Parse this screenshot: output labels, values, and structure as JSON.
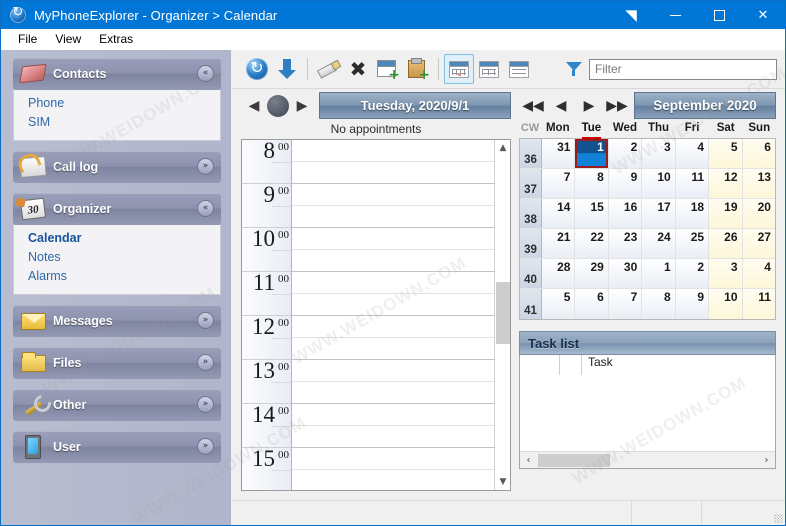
{
  "window": {
    "title": "MyPhoneExplorer -  Organizer > Calendar",
    "icon": "sync-circle-icon",
    "buttons": {
      "restore_small": "restore-triangle-icon",
      "minimize": "minimize-icon",
      "maximize": "maximize-icon",
      "close": "✕"
    }
  },
  "menu": {
    "items": [
      "File",
      "View",
      "Extras"
    ]
  },
  "sidebar": {
    "groups": [
      {
        "label": "Contacts",
        "icon": "book-icon",
        "expanded": true,
        "chevron": "«",
        "items": [
          {
            "label": "Phone",
            "selected": false
          },
          {
            "label": "SIM",
            "selected": false
          }
        ]
      },
      {
        "label": "Call log",
        "icon": "phone-log-icon",
        "expanded": false,
        "chevron": "»",
        "items": []
      },
      {
        "label": "Organizer",
        "icon": "calendar-30-icon",
        "expanded": true,
        "chevron": "«",
        "items": [
          {
            "label": "Calendar",
            "selected": true
          },
          {
            "label": "Notes",
            "selected": false
          },
          {
            "label": "Alarms",
            "selected": false
          }
        ]
      },
      {
        "label": "Messages",
        "icon": "envelope-icon",
        "expanded": false,
        "chevron": "»",
        "items": []
      },
      {
        "label": "Files",
        "icon": "folder-icon",
        "expanded": false,
        "chevron": "»",
        "items": []
      },
      {
        "label": "Other",
        "icon": "wrench-icon",
        "expanded": false,
        "chevron": "»",
        "items": []
      },
      {
        "label": "User",
        "icon": "device-icon",
        "expanded": false,
        "chevron": "»",
        "items": []
      }
    ]
  },
  "toolbar": {
    "buttons": [
      {
        "name": "sync-button",
        "icon": "sync-icon"
      },
      {
        "name": "download-button",
        "icon": "download-arrow-icon"
      },
      {
        "name": "edit-button",
        "icon": "pencil-icon"
      },
      {
        "name": "delete-button",
        "icon": "x-delete-icon"
      },
      {
        "name": "new-appointment-button",
        "icon": "calendar-plus-icon"
      },
      {
        "name": "new-task-button",
        "icon": "clipboard-plus-icon"
      },
      {
        "name": "calendar-view-button",
        "icon": "calendar-view-icon",
        "active": true
      },
      {
        "name": "table-view-button",
        "icon": "table-view-icon",
        "active": false
      },
      {
        "name": "list-view-button",
        "icon": "list-view-icon",
        "active": false
      }
    ],
    "filter": {
      "icon": "funnel-icon",
      "placeholder": "Filter",
      "value": ""
    }
  },
  "day_view": {
    "nav": {
      "prev": "◀",
      "today": "today-dot",
      "next": "▶",
      "date_label": "Tuesday, 2020/9/1"
    },
    "appointments_status": "No appointments",
    "hours": [
      {
        "hour": "8",
        "minutes": "00"
      },
      {
        "hour": "9",
        "minutes": "00"
      },
      {
        "hour": "10",
        "minutes": "00"
      },
      {
        "hour": "11",
        "minutes": "00"
      },
      {
        "hour": "12",
        "minutes": "00"
      },
      {
        "hour": "13",
        "minutes": "00"
      },
      {
        "hour": "14",
        "minutes": "00"
      },
      {
        "hour": "15",
        "minutes": "00"
      }
    ]
  },
  "month_view": {
    "nav": {
      "prev_year": "◀◀",
      "prev_month": "◀",
      "next_month": "▶",
      "next_year": "▶▶",
      "month_label": "September 2020"
    },
    "headers": {
      "cw": "CW",
      "days": [
        "Mon",
        "Tue",
        "Wed",
        "Thu",
        "Fri",
        "Sat",
        "Sun"
      ],
      "today_column": "Tue"
    },
    "weeks": [
      {
        "cw": "36",
        "days": [
          {
            "n": "31",
            "weekend": false,
            "selected": false
          },
          {
            "n": "1",
            "weekend": false,
            "selected": true
          },
          {
            "n": "2",
            "weekend": false,
            "selected": false
          },
          {
            "n": "3",
            "weekend": false,
            "selected": false
          },
          {
            "n": "4",
            "weekend": false,
            "selected": false
          },
          {
            "n": "5",
            "weekend": true,
            "selected": false
          },
          {
            "n": "6",
            "weekend": true,
            "selected": false
          }
        ]
      },
      {
        "cw": "37",
        "days": [
          {
            "n": "7",
            "weekend": false,
            "selected": false
          },
          {
            "n": "8",
            "weekend": false,
            "selected": false
          },
          {
            "n": "9",
            "weekend": false,
            "selected": false
          },
          {
            "n": "10",
            "weekend": false,
            "selected": false
          },
          {
            "n": "11",
            "weekend": false,
            "selected": false
          },
          {
            "n": "12",
            "weekend": true,
            "selected": false
          },
          {
            "n": "13",
            "weekend": true,
            "selected": false
          }
        ]
      },
      {
        "cw": "38",
        "days": [
          {
            "n": "14",
            "weekend": false,
            "selected": false
          },
          {
            "n": "15",
            "weekend": false,
            "selected": false
          },
          {
            "n": "16",
            "weekend": false,
            "selected": false
          },
          {
            "n": "17",
            "weekend": false,
            "selected": false
          },
          {
            "n": "18",
            "weekend": false,
            "selected": false
          },
          {
            "n": "19",
            "weekend": true,
            "selected": false
          },
          {
            "n": "20",
            "weekend": true,
            "selected": false
          }
        ]
      },
      {
        "cw": "39",
        "days": [
          {
            "n": "21",
            "weekend": false,
            "selected": false
          },
          {
            "n": "22",
            "weekend": false,
            "selected": false
          },
          {
            "n": "23",
            "weekend": false,
            "selected": false
          },
          {
            "n": "24",
            "weekend": false,
            "selected": false
          },
          {
            "n": "25",
            "weekend": false,
            "selected": false
          },
          {
            "n": "26",
            "weekend": true,
            "selected": false
          },
          {
            "n": "27",
            "weekend": true,
            "selected": false
          }
        ]
      },
      {
        "cw": "40",
        "days": [
          {
            "n": "28",
            "weekend": false,
            "selected": false
          },
          {
            "n": "29",
            "weekend": false,
            "selected": false
          },
          {
            "n": "30",
            "weekend": false,
            "selected": false
          },
          {
            "n": "1",
            "weekend": false,
            "selected": false
          },
          {
            "n": "2",
            "weekend": false,
            "selected": false
          },
          {
            "n": "3",
            "weekend": true,
            "selected": false
          },
          {
            "n": "4",
            "weekend": true,
            "selected": false
          }
        ]
      },
      {
        "cw": "41",
        "days": [
          {
            "n": "5",
            "weekend": false,
            "selected": false
          },
          {
            "n": "6",
            "weekend": false,
            "selected": false
          },
          {
            "n": "7",
            "weekend": false,
            "selected": false
          },
          {
            "n": "8",
            "weekend": false,
            "selected": false
          },
          {
            "n": "9",
            "weekend": false,
            "selected": false
          },
          {
            "n": "10",
            "weekend": true,
            "selected": false
          },
          {
            "n": "11",
            "weekend": true,
            "selected": false
          }
        ]
      }
    ]
  },
  "task_list": {
    "title": "Task list",
    "columns": [
      "",
      "",
      "Task"
    ],
    "rows": [],
    "scroll_left": "‹",
    "scroll_right": "›"
  },
  "status_bar": {
    "section_1": "",
    "section_2": "",
    "section_3": ""
  },
  "watermarks": [
    "WWW.WEIDOWN.COM",
    "WWW.WEIDOWN.COM",
    "WWW.WEIDOWN.COM",
    "WWW.WEIDOWN.COM",
    "WWW.WEIDOWN.COM",
    "WWW.WEIDOWN.COM"
  ],
  "colors": {
    "titlebar": "#0076d7",
    "accent_blue": "#1182d8",
    "selection_border": "#9e1b1b",
    "weekend_bg": "#fdf6d8",
    "sidebar_bg": "#b0b5cb",
    "link": "#2f68a8"
  }
}
